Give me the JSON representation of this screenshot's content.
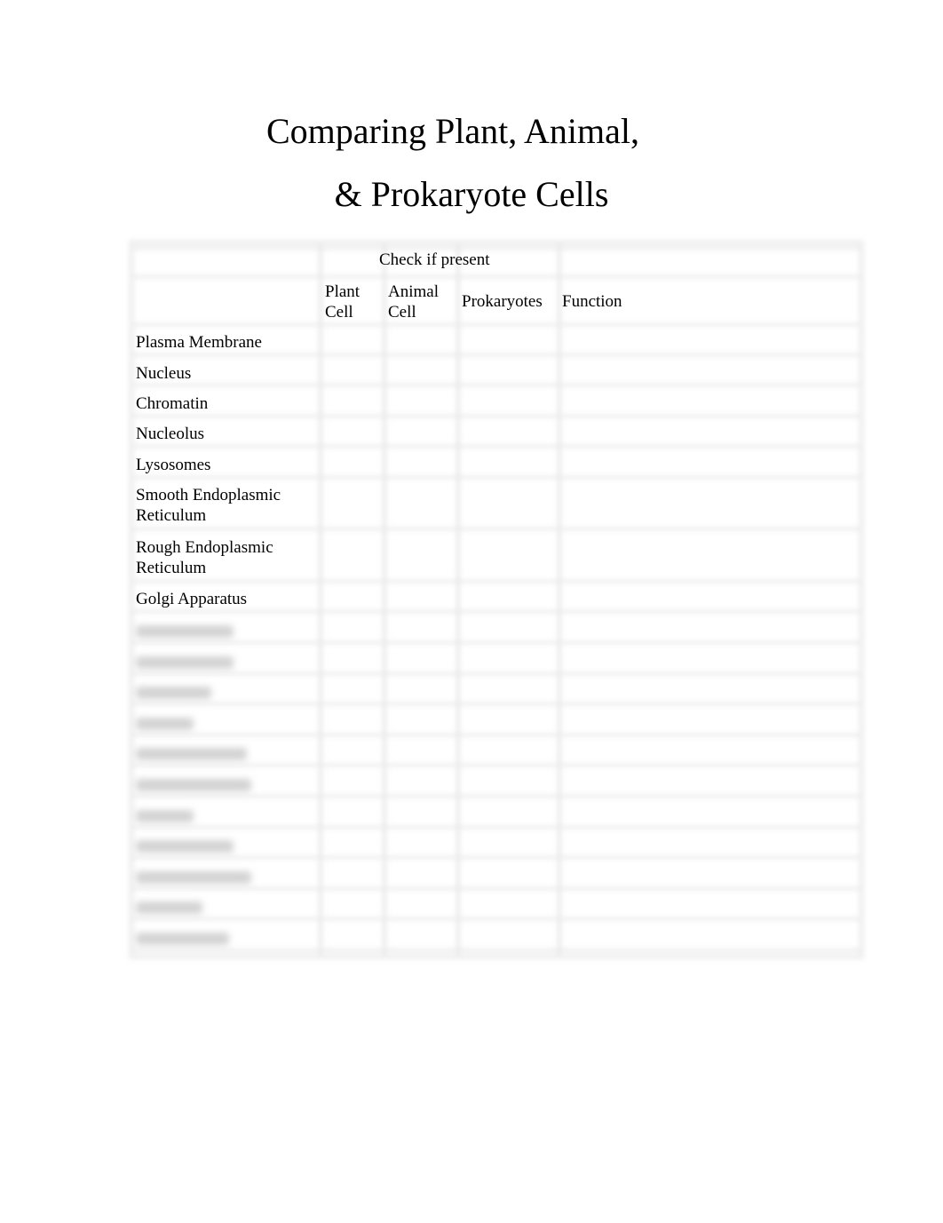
{
  "document": {
    "title_line1": "Comparing Plant, Animal,",
    "title_line2": "& Prokaryote Cells"
  },
  "table": {
    "group_header": "Check if present",
    "columns": {
      "plant_line1": "Plant",
      "plant_line2": "Cell",
      "animal_line1": "Animal",
      "animal_line2": "Cell",
      "prokaryotes": "Prokaryotes",
      "function": "Function"
    },
    "rows": [
      {
        "line1": "Plasma Membrane",
        "line2": ""
      },
      {
        "line1": "Nucleus",
        "line2": ""
      },
      {
        "line1": "Chromatin",
        "line2": ""
      },
      {
        "line1": "Nucleolus",
        "line2": ""
      },
      {
        "line1": "Lysosomes",
        "line2": ""
      },
      {
        "line1": "Smooth Endoplasmic",
        "line2": "Reticulum"
      },
      {
        "line1": "Rough Endoplasmic",
        "line2": "Reticulum"
      },
      {
        "line1": "Golgi Apparatus",
        "line2": ""
      }
    ],
    "blurred_row_count": 11
  }
}
